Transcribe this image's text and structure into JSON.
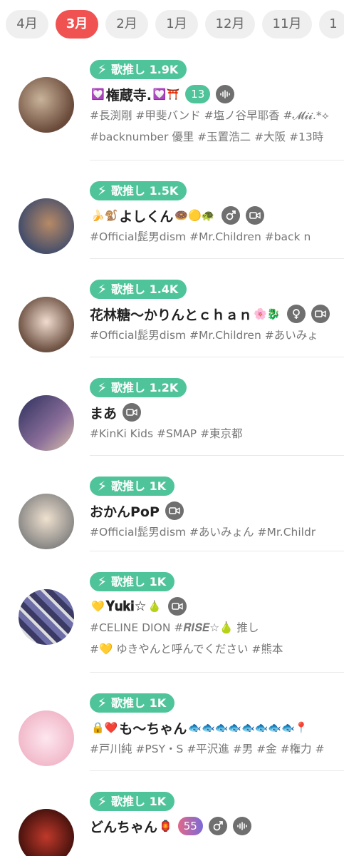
{
  "tabs": [
    {
      "label": "4月",
      "active": false
    },
    {
      "label": "3月",
      "active": true
    },
    {
      "label": "2月",
      "active": false
    },
    {
      "label": "1月",
      "active": false
    },
    {
      "label": "12月",
      "active": false
    },
    {
      "label": "11月",
      "active": false
    },
    {
      "label": "1",
      "active": false
    }
  ],
  "badge_prefix": "歌推し",
  "colors": {
    "accent": "#f05151",
    "badge": "#4fc49a",
    "icon_bg": "#6f6f6f",
    "level_teal": "#4fc49a",
    "level_pink": "#e0688a"
  },
  "users": [
    {
      "badge": "歌推し 1.9K",
      "name": "権蔵寺.",
      "prefix_emoji": "💟 ",
      "suffix_emoji": "💟⛩️",
      "level": "13",
      "icons": [
        "voice-icon"
      ],
      "tags": [
        "#長渕剛 #甲斐バンド #塩ノ谷早耶香 #𝓜𝓲𝓲.*⟡",
        "#backnumber 優里 #玉置浩二 #大阪 #13時"
      ]
    },
    {
      "badge": "歌推し 1.5K",
      "name": "よしくん",
      "prefix_emoji": "🍌🐒",
      "suffix_emoji": "🍩🟡🐢",
      "icons": [
        "male-icon",
        "video-icon"
      ],
      "tags": [
        "#Official髭男dism #Mr.Children #back n"
      ]
    },
    {
      "badge": "歌推し 1.4K",
      "name": "花林糖〜かりんとｃｈａｎ",
      "prefix_emoji": "",
      "suffix_emoji": "🌸🐉",
      "icons": [
        "female-icon",
        "video-icon"
      ],
      "tags": [
        "#Official髭男dism #Mr.Children #あいみょ"
      ]
    },
    {
      "badge": "歌推し 1.2K",
      "name": "まあ",
      "prefix_emoji": "",
      "suffix_emoji": "",
      "icons": [
        "video-icon"
      ],
      "tags": [
        "#KinKi Kids #SMAP #東京都"
      ]
    },
    {
      "badge": "歌推し 1K",
      "name": "おかんPoP",
      "prefix_emoji": "",
      "suffix_emoji": "",
      "icons": [
        "video-icon"
      ],
      "tags": [
        "#Official髭男dism #あいみょん #Mr.Childr"
      ]
    },
    {
      "badge": "歌推し 1K",
      "name": "𝐘𝐮𝐤𝐢☆",
      "prefix_emoji": "💛",
      "suffix_emoji": "🍐",
      "icons": [
        "video-icon"
      ],
      "tags": [
        "#CELINE DION #𝑹𝑰𝑺𝑬☆🍐 推し",
        "#💛 ゆきやんと呼んでください #熊本"
      ]
    },
    {
      "badge": "歌推し 1K",
      "name": "も〜ちゃん",
      "prefix_emoji": "🔒❤️",
      "suffix_emoji": "🐟🐟🐟🐟🐟🐟🐟🐟📍",
      "icons": [],
      "tags": [
        "#戸川純 #PSY・S #平沢進 #男 #金 #権力 #"
      ]
    },
    {
      "badge": "歌推し 1K",
      "name": "どんちゃん",
      "prefix_emoji": "",
      "suffix_emoji": "🏮",
      "level": "55",
      "level_style": "pink",
      "icons": [
        "male-icon",
        "voice-icon"
      ],
      "tags": []
    }
  ]
}
